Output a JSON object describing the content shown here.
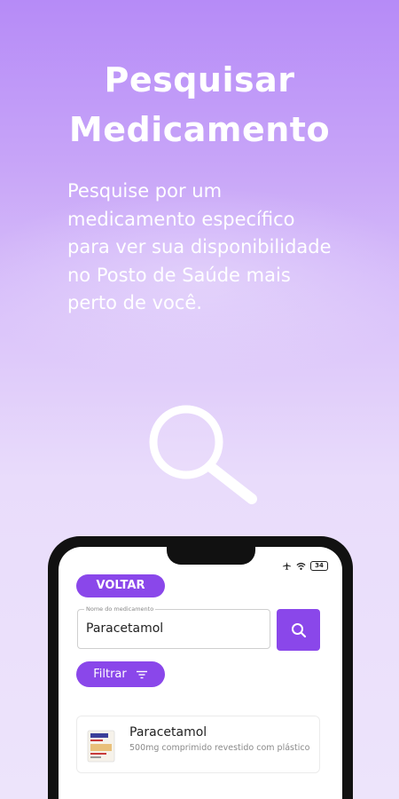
{
  "intro": {
    "title_line1": "Pesquisar",
    "title_line2": "Medicamento",
    "description": "Pesquise por um medicamento específico para ver sua disponibilidade no Posto de Saúde mais perto de você."
  },
  "illustration_icon": "magnifier-icon",
  "phone": {
    "status_bar": {
      "icons": [
        "airplane-icon",
        "wifi-icon",
        "battery-icon"
      ],
      "battery_level": "34"
    },
    "back_button_label": "VOLTAR",
    "search": {
      "label": "Nome do medicamento",
      "value": "Paracetamol",
      "button_icon": "search-icon"
    },
    "filter": {
      "label": "Filtrar",
      "icon": "filter-icon"
    },
    "results": [
      {
        "name": "Paracetamol",
        "description": "500mg comprimido revestido com plástico",
        "image_icon": "medicine-box-icon"
      }
    ]
  },
  "colors": {
    "accent": "#8a47ea",
    "background_top": "#b68bf7",
    "background_bottom": "#ede4fb"
  }
}
